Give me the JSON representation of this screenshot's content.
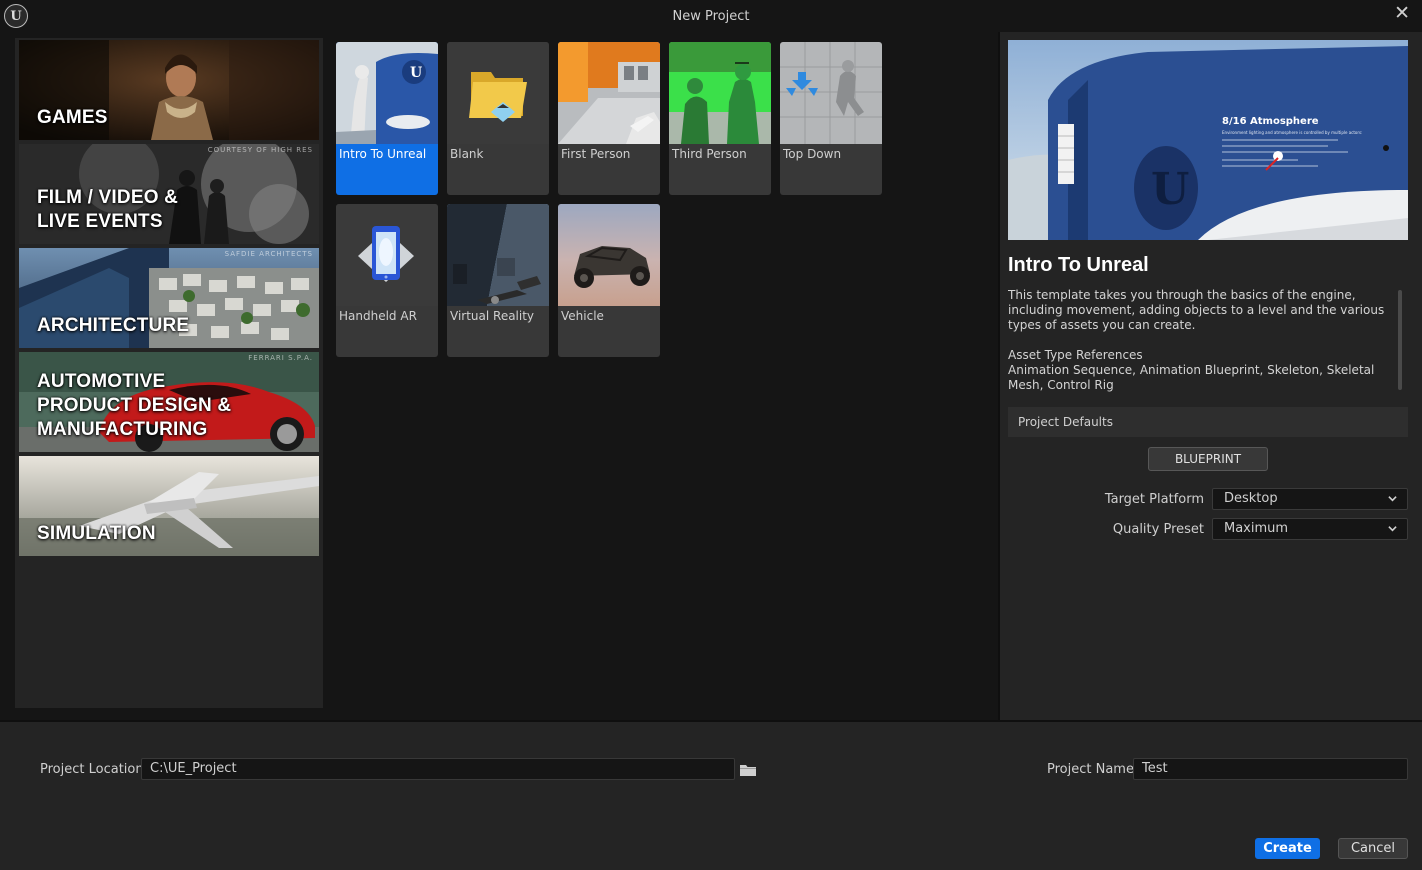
{
  "window": {
    "title": "New Project",
    "logo_letter": "U",
    "close_glyph": "✕"
  },
  "categories": [
    {
      "label": "GAMES",
      "credit": ""
    },
    {
      "label": "FILM / VIDEO &\nLIVE EVENTS",
      "credit": "COURTESY OF HIGH RES"
    },
    {
      "label": "ARCHITECTURE",
      "credit": "SAFDIE ARCHITECTS"
    },
    {
      "label": "AUTOMOTIVE\nPRODUCT DESIGN &\nMANUFACTURING",
      "credit": "FERRARI S.P.A."
    },
    {
      "label": "SIMULATION",
      "credit": ""
    }
  ],
  "selected_category": "GAMES",
  "templates": [
    {
      "label": "Intro To Unreal"
    },
    {
      "label": "Blank"
    },
    {
      "label": "First Person"
    },
    {
      "label": "Third Person"
    },
    {
      "label": "Top Down"
    },
    {
      "label": "Handheld AR"
    },
    {
      "label": "Virtual Reality"
    },
    {
      "label": "Vehicle"
    }
  ],
  "selected_template": "Intro To Unreal",
  "details": {
    "title": "Intro To Unreal",
    "description": "This template takes you through the basics of the engine, including movement, adding objects to a level and the various types of assets you can create.\n\nAsset Type References\nAnimation Sequence, Animation Blueprint, Skeleton, Skeletal Mesh, Control Rig\n\nClass Type References",
    "preview_sign_title": "8/16 Atmosphere",
    "preview_sign_text": "Environment lighting and atmosphere is controlled by multiple actors:"
  },
  "project_defaults": {
    "header": "Project Defaults",
    "blueprint_label": "BLUEPRINT",
    "target_platform_label": "Target Platform",
    "target_platform_value": "Desktop",
    "quality_preset_label": "Quality Preset",
    "quality_preset_value": "Maximum"
  },
  "bottom": {
    "location_label": "Project Location",
    "location_value": "C:\\UE_Project",
    "name_label": "Project Name",
    "name_value": "Test",
    "create_label": "Create",
    "cancel_label": "Cancel"
  },
  "colors": {
    "accent": "#0f6fe5",
    "selection_outline": "#3e7fd6",
    "panel": "#242424",
    "background": "#151515"
  }
}
